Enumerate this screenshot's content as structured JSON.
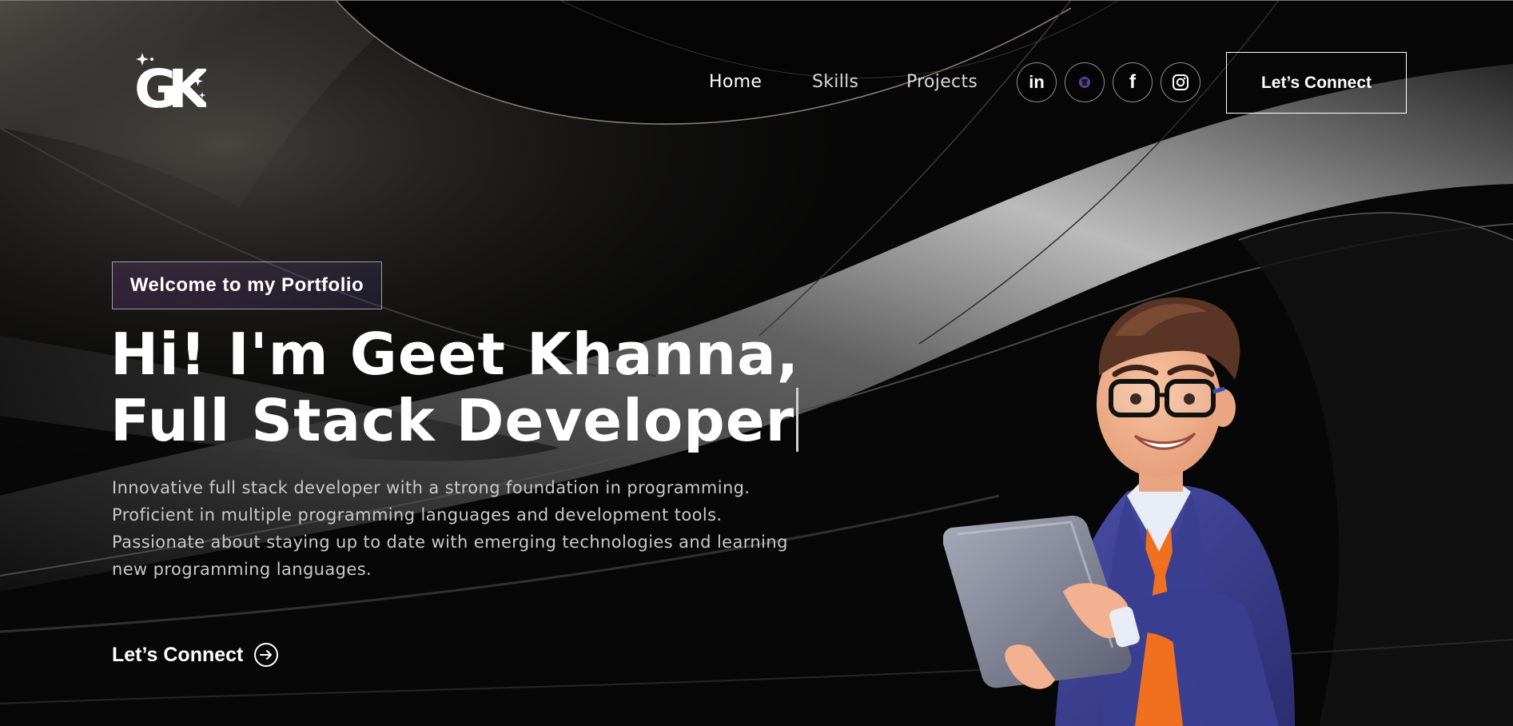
{
  "brand": {
    "logo_text": "GK"
  },
  "nav": {
    "links": [
      {
        "label": "Home",
        "active": true
      },
      {
        "label": "Skills",
        "active": false
      },
      {
        "label": "Projects",
        "active": false
      }
    ],
    "socials": [
      {
        "icon": "linkedin-icon",
        "label": "in"
      },
      {
        "icon": "github-icon",
        "label": ""
      },
      {
        "icon": "facebook-icon",
        "label": "f"
      },
      {
        "icon": "instagram-icon",
        "label": ""
      }
    ],
    "cta_label": "Let’s Connect"
  },
  "hero": {
    "tagline": "Welcome to my Portfolio",
    "title_line1": "Hi! I'm Geet Khanna,",
    "title_line2": "Full Stack Developer",
    "description": [
      "Innovative full stack developer with a strong foundation in programming.",
      "Proficient in multiple programming languages and development tools.",
      "Passionate about staying up to date with emerging technologies and learning",
      "new programming languages."
    ],
    "connect_label": "Let’s Connect",
    "connect_icon": "arrow-right-circle-icon"
  },
  "colors": {
    "background": "#070707",
    "text": "#ffffff",
    "muted_text": "#c9c9c9",
    "avatar_jacket": "#3d3f8f",
    "avatar_shirt": "#f07020"
  }
}
